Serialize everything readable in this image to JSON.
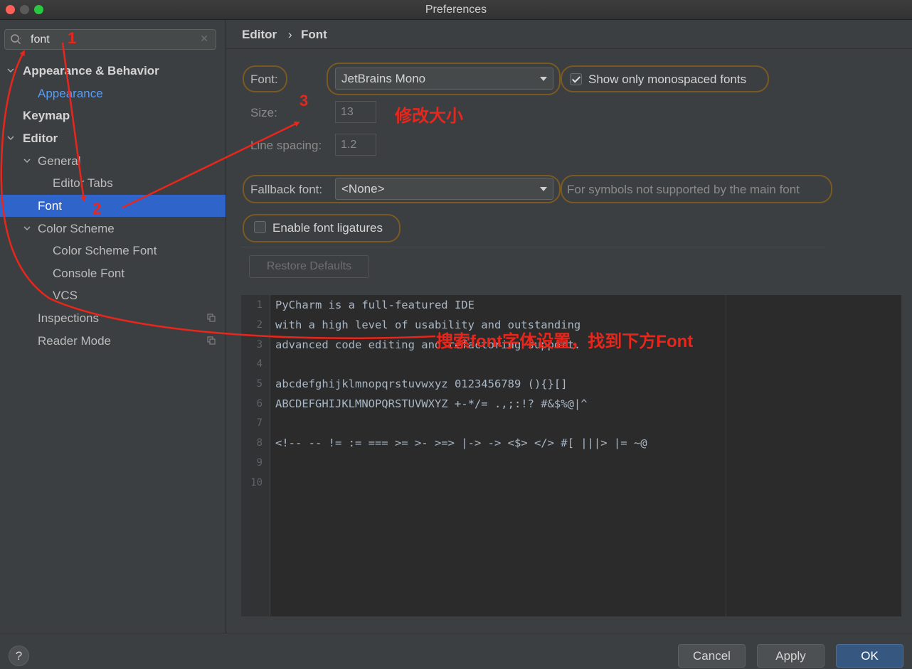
{
  "window": {
    "title": "Preferences"
  },
  "search": {
    "value": "font"
  },
  "tree": {
    "appearance_behavior": "Appearance & Behavior",
    "appearance": "Appearance",
    "keymap": "Keymap",
    "editor": "Editor",
    "general": "General",
    "editor_tabs": "Editor Tabs",
    "font": "Font",
    "color_scheme": "Color Scheme",
    "color_scheme_font": "Color Scheme Font",
    "console_font": "Console Font",
    "vcs": "VCS",
    "inspections": "Inspections",
    "reader_mode": "Reader Mode"
  },
  "breadcrumb": {
    "parent": "Editor",
    "separator": "›",
    "current": "Font"
  },
  "form": {
    "font_label": "Font:",
    "font_value": "JetBrains Mono",
    "mono_only_label": "Show only monospaced fonts",
    "mono_only_checked": true,
    "size_label": "Size:",
    "size_value": "13",
    "line_spacing_label": "Line spacing:",
    "line_spacing_value": "1.2",
    "fallback_label": "Fallback font:",
    "fallback_value": "<None>",
    "fallback_hint": "For symbols not supported by the main font",
    "ligatures_label": "Enable font ligatures",
    "ligatures_checked": false,
    "restore_label": "Restore Defaults"
  },
  "preview": {
    "line_numbers": [
      "1",
      "2",
      "3",
      "4",
      "5",
      "6",
      "7",
      "8",
      "9",
      "10"
    ],
    "lines": [
      "PyCharm is a full-featured IDE",
      "with a high level of usability and outstanding",
      "advanced code editing and refactoring support.",
      "",
      "abcdefghijklmnopqrstuvwxyz 0123456789 (){}[]",
      "ABCDEFGHIJKLMNOPQRSTUVWXYZ +-*/= .,;:!? #&$%@|^",
      "",
      "<!-- -- != := === >= >- >=> |-> -> <$> </> #[ |||> |= ~@",
      "",
      ""
    ]
  },
  "footer": {
    "help": "?",
    "cancel": "Cancel",
    "apply": "Apply",
    "ok": "OK"
  },
  "annotations": {
    "step1": "1",
    "step2": "2",
    "step3": "3",
    "size_note": "修改大小",
    "search_note": "搜索font字体设置，找到下方Font",
    "color": "#e8261c"
  },
  "colors": {
    "selection": "#2f65ca",
    "link": "#589df6",
    "primary_button": "#365880",
    "highlight_ring": "#7a5a22"
  }
}
